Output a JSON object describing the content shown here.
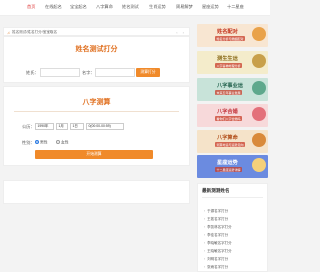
{
  "nav": {
    "items": [
      "首页",
      "在线起名",
      "宝宝起名",
      "八字算命",
      "姓名测试",
      "生肖运势",
      "周易解梦",
      "星座运势",
      "十二星座"
    ],
    "active_index": 0
  },
  "notice": {
    "text": "姓名测试/姓名打分/宝宝取名",
    "arrows": "‹ ›"
  },
  "name_test": {
    "title": "姓名测试打分",
    "surname_label": "姓氏：",
    "name_label": "名字：",
    "button_label": "测算打分"
  },
  "bazi": {
    "title": "八字测算",
    "birth_label": "公历：",
    "year": "1990年",
    "month": "1月",
    "day": "1日",
    "hour": "0(00:00-00:59)",
    "gender_label": "性别：",
    "male": "男性",
    "female": "女性",
    "button_label": "开始测算"
  },
  "banners": [
    {
      "label": "姓名配对",
      "sub": "姓名分析与婚姻配对",
      "bg": "#f8e6d2",
      "color": "#c4361f",
      "deco": "#e9a24a"
    },
    {
      "label": "测生生运",
      "sub": "八字喜神命理分析",
      "bg": "#f4eccb",
      "color": "#8a6a18",
      "deco": "#c8a04a"
    },
    {
      "label": "八字事业运",
      "sub": "未来五年事业发展",
      "bg": "#c8e3d9",
      "color": "#1f5f4a",
      "deco": "#5ea88c"
    },
    {
      "label": "八字合婚",
      "sub": "看你们八字合婚吗",
      "bg": "#f7d9da",
      "color": "#c2323a",
      "deco": "#e3707a"
    },
    {
      "label": "八字算命",
      "sub": "测算命运与运势走向",
      "bg": "#f5e3c9",
      "color": "#b2501c",
      "deco": "#d98a3a"
    },
    {
      "label": "星座运势",
      "sub": "十二星座运势详解",
      "bg": "#6b8be0",
      "color": "#ffffff",
      "deco": "#f4d07a"
    }
  ],
  "side_list": {
    "heading": "最新测测姓名",
    "items": [
      "于源名字打分",
      "王茗名字打分",
      "李凯林名字打分",
      "李佳名字打分",
      "李晓敏名字打分",
      "王晓敏名字打分",
      "刘明名字打分",
      "张雨名字打分"
    ]
  }
}
